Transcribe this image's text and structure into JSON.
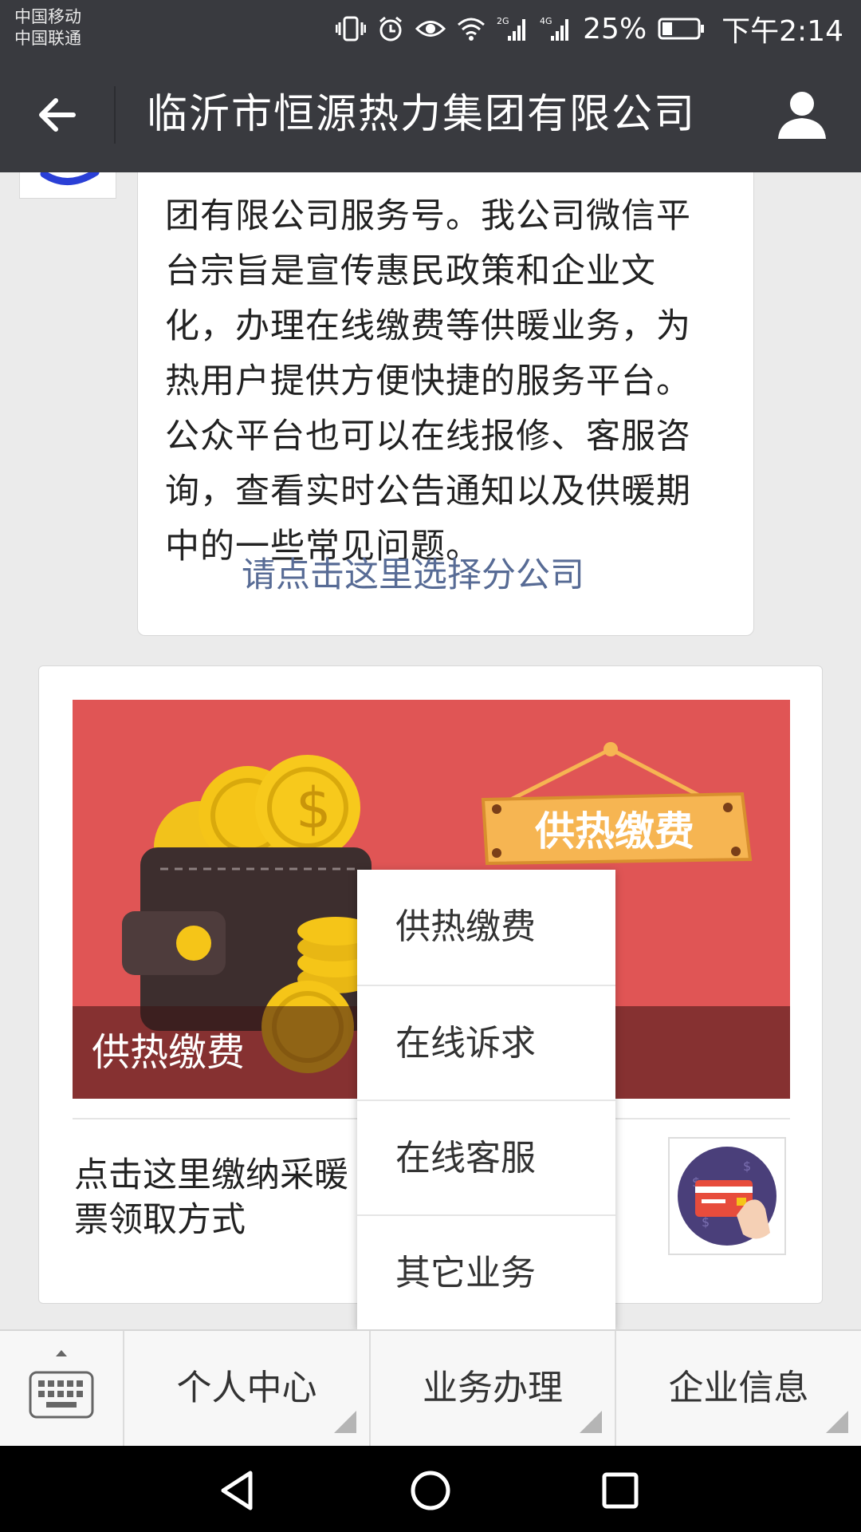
{
  "status_bar": {
    "carrier_1": "中国移动",
    "carrier_2": "中国联通",
    "signal_1_label": "2G",
    "signal_2_label": "4G",
    "battery": "25%",
    "time": "下午2:14"
  },
  "nav": {
    "title": "临沂市恒源热力集团有限公司",
    "back_icon": "arrow-left-icon",
    "profile_icon": "person-icon"
  },
  "message": {
    "lines": [
      "团有限公司服务号。我公司微信平",
      "台宗旨是宣传惠民政策和企业文",
      "化，办理在线缴费等供暖业务，为",
      "热用户提供方便快捷的服务平台。",
      "公众平台也可以在线报修、客服咨",
      "询，查看实时公告通知以及供暖期",
      "中的一些常见问题。"
    ],
    "link": "请点击这里选择分公司"
  },
  "card": {
    "banner_sign": "供热缴费",
    "banner_caption": "供热缴费",
    "subtitle_line1": "点击这里缴纳采暖",
    "subtitle_line2": "票领取方式"
  },
  "popup_menu": {
    "items": [
      "供热缴费",
      "在线诉求",
      "在线客服",
      "其它业务"
    ]
  },
  "bottom_menu": {
    "tabs": [
      "个人中心",
      "业务办理",
      "企业信息"
    ]
  },
  "colors": {
    "bar": "#393a3f",
    "link": "#576b95",
    "banner": "#e05555",
    "coin": "#f5c518",
    "wallet": "#3d2e2e",
    "sign": "#f6b552"
  }
}
